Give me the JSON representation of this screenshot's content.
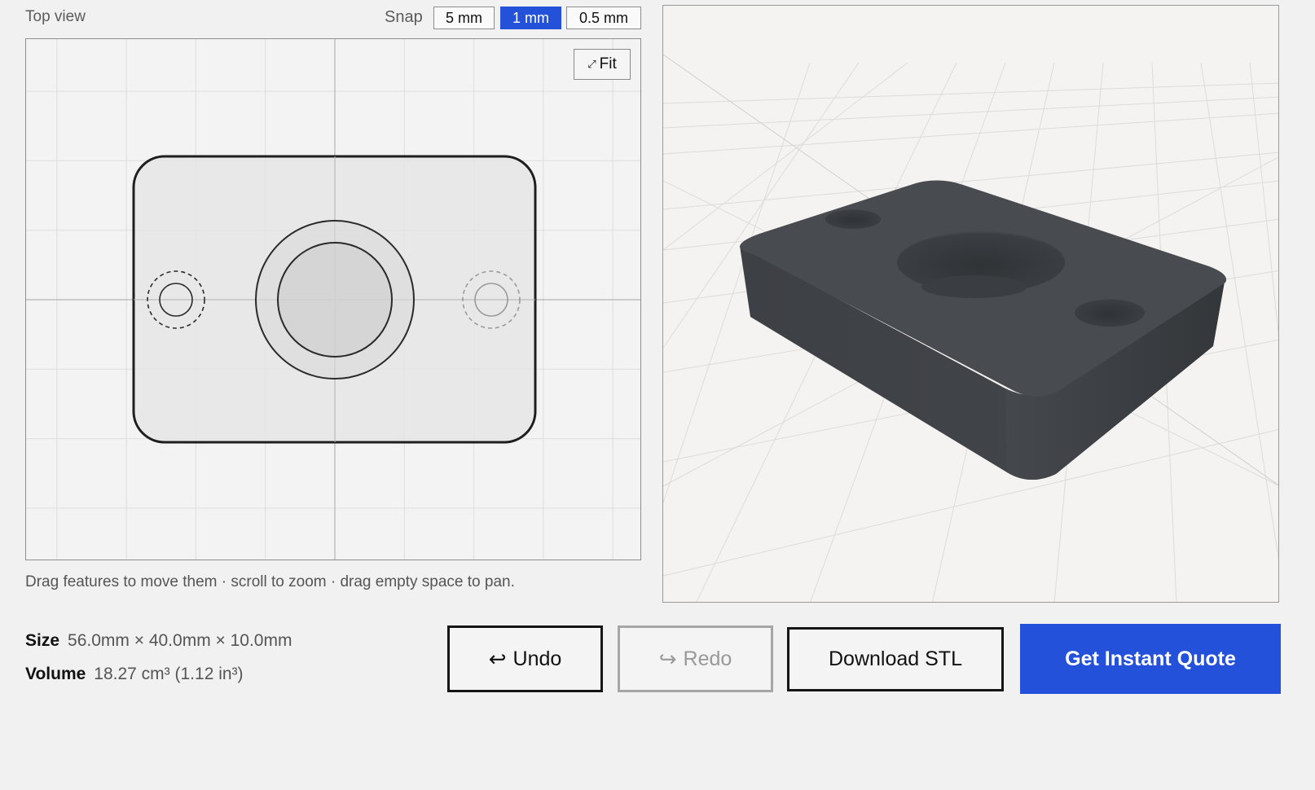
{
  "top_view": {
    "title": "Top view",
    "snap_label": "Snap",
    "snap_options": [
      "5 mm",
      "1 mm",
      "0.5 mm"
    ],
    "snap_selected": "1 mm",
    "fit_label": "Fit",
    "fit_icon": "expand-arrows-icon",
    "hint": "Drag features to move them · scroll to zoom · drag empty space to pan."
  },
  "model": {
    "size_label": "Size",
    "size_value": "56.0mm × 40.0mm × 10.0mm",
    "volume_label": "Volume",
    "volume_value": "18.27 cm³ (1.12 in³)"
  },
  "actions": {
    "undo_label": "Undo",
    "undo_icon": "undo-arrow-icon",
    "redo_label": "Redo",
    "redo_icon": "redo-arrow-icon",
    "redo_enabled": false,
    "download_label": "Download STL",
    "quote_label": "Get Instant Quote"
  },
  "colors": {
    "accent": "#2451d9",
    "part_fill_2d": "#e4e4e4",
    "part_3d": "#45484c",
    "background": "#f1f1f1"
  }
}
